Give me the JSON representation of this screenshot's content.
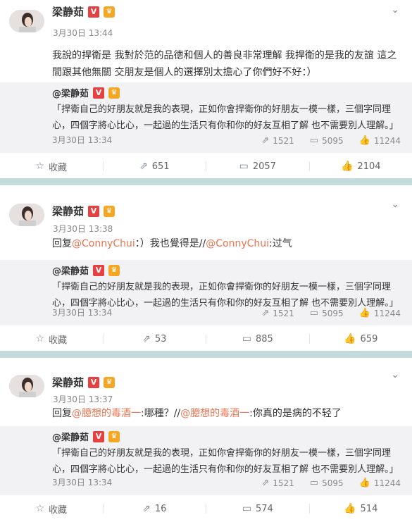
{
  "posts": [
    {
      "user": "梁静茹",
      "verified": "V",
      "time": "3月30日 13:44",
      "text": "我說的捍衛是 我對於范的品德和個人的善良非常理解 我捍衛的是我的友誼 這之間跟其他無關 交朋友是個人的選擇別太擔心了你們好不好：）",
      "retweet": {
        "user": "@梁静茹",
        "text": "「捍衛自己的好朋友就是我的表現，正如你會捍衛你的好朋友一模一樣，三個字同理心，四個字將心比心，一起過的生活只有你和你的好友互相了解 也不需要別人理解。」",
        "time": "3月30日 13:34",
        "reposts": "1521",
        "comments": "5095",
        "likes": "11244"
      },
      "actions": {
        "favorite": "收藏",
        "repost": "651",
        "comment": "2057",
        "like": "2104"
      }
    },
    {
      "user": "梁静茹",
      "verified": "V",
      "time": "3月30日 13:38",
      "text_prefix": "回复",
      "mention1": "@ConnyChui",
      "text_mid": "：）我也覺得是//",
      "mention2": "@ConnyChui",
      "text_suffix": ":过气",
      "retweet": {
        "user": "@梁静茹",
        "text": "「捍衛自己的好朋友就是我的表現，正如你會捍衛你的好朋友一模一樣，三個字同理心，四個字將心比心，一起過的生活只有你和你的好友互相了解 也不需要別人理解。」",
        "time": "3月30日 13:34",
        "reposts": "1521",
        "comments": "5095",
        "likes": "11244"
      },
      "actions": {
        "favorite": "收藏",
        "repost": "53",
        "comment": "885",
        "like": "659"
      }
    },
    {
      "user": "梁静茹",
      "verified": "V",
      "time": "3月30日 13:37",
      "text_prefix": "回复",
      "mention1": "@臆想的毒酒一",
      "text_mid": ":哪種？//",
      "mention2": "@臆想的毒酒一",
      "text_suffix": ":你真的是病的不轻了",
      "retweet": {
        "user": "@梁静茹",
        "text": "「捍衛自己的好朋友就是我的表現，正如你會捍衛你的好朋友一模一樣，三個字同理心，四個字將心比心，一起過的生活只有你和你的好友互相了解 也不需要別人理解。」",
        "time": "3月30日 13:34",
        "reposts": "1521",
        "comments": "5095",
        "likes": "11244"
      },
      "actions": {
        "favorite": "收藏",
        "repost": "16",
        "comment": "574",
        "like": "514"
      }
    }
  ]
}
